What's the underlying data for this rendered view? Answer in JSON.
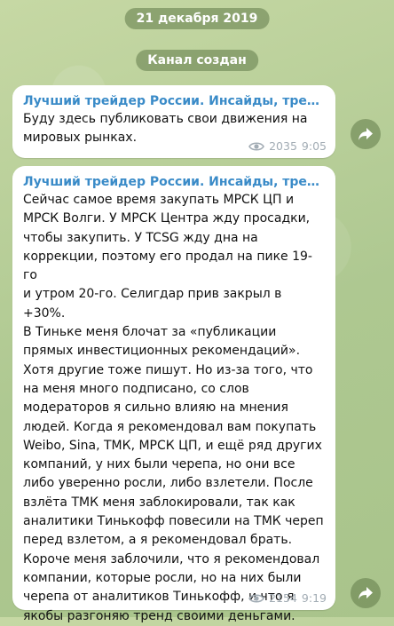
{
  "date_badge": "21 декабря 2019",
  "service_badge": "Канал создан",
  "messages": [
    {
      "sender": "Лучший трейдер России. Инсайды, трейдинг",
      "text": "Буду здесь публиковать свои движения на\nмировых рынках.",
      "views": "2035",
      "time": "9:05"
    },
    {
      "sender": "Лучший трейдер России. Инсайды, трейдинг",
      "text": "Сейчас самое время закупать МРСК ЦП и\nМРСК Волги. У МРСК Центра жду просадки,\nчтобы закупить. У TCSG жду дна на\nкоррекции, поэтому его продал на пике 19-го\nи утром 20-го. Селигдар прив закрыл в  +30%.\nВ Тинькe меня блочат за «публикации\nпрямых инвестиционных рекомендаций».\nХотя другие тоже пишут. Но из-за того, что\nна меня много подписано, со слов\nмодераторов я сильно влияю на мнения\nлюдей. Когда я рекомендовал вам покупать\nWeibo, Sina, ТМК, МРСК ЦП, и ещё ряд других\nкомпаний, у них были черепа, но они все\nлибо уверенно росли, либо взлетели. После\nвзлёта ТМК меня заблокировали, так как\nаналитики Тинькофф повесили на ТМК череп\nперед взлетом, а я рекомендовал брать.\nКороче меня заблочили, что я рекомендовал\nкомпании, которые росли, но на них были\nчерепа от аналитиков Тинькофф, и что я\nякобы разгоняю тренд своими деньгами.",
      "views": "2154",
      "time": "9:19"
    }
  ],
  "icons": {
    "views": "eye-icon",
    "share": "share-arrow-icon"
  }
}
